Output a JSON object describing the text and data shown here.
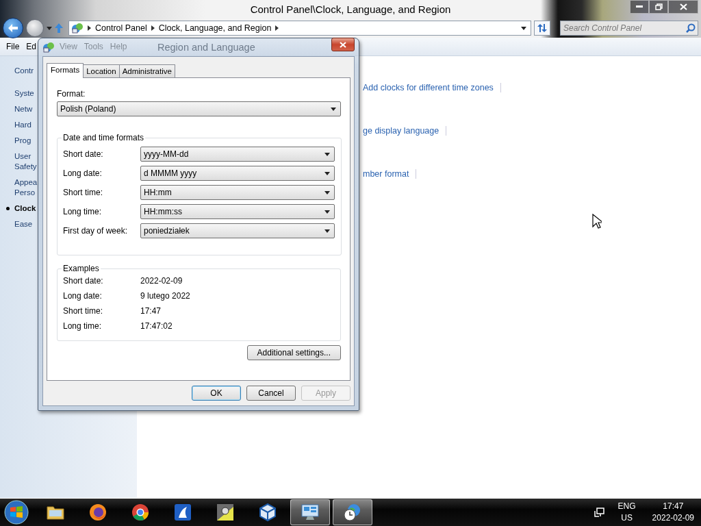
{
  "window": {
    "title": "Control Panel\\Clock, Language, and Region"
  },
  "address_bar": {
    "breadcrumbs": [
      "Control Panel",
      "Clock, Language, and Region"
    ]
  },
  "search": {
    "placeholder": "Search Control Panel"
  },
  "menu": [
    "File",
    "Ed",
    "View",
    "Tools",
    "Help"
  ],
  "sidebar": {
    "items": [
      {
        "lines": [
          "Contr"
        ],
        "selected": false
      },
      {
        "lines": [
          "Syste"
        ],
        "selected": false
      },
      {
        "lines": [
          "Netw"
        ],
        "selected": false
      },
      {
        "lines": [
          "Hard"
        ],
        "selected": false
      },
      {
        "lines": [
          "Prog"
        ],
        "selected": false
      },
      {
        "lines": [
          "User",
          "Safety"
        ],
        "selected": false
      },
      {
        "lines": [
          "Appea",
          "Perso"
        ],
        "selected": false
      },
      {
        "lines": [
          "Clock"
        ],
        "selected": true
      },
      {
        "lines": [
          "Ease"
        ],
        "selected": false
      }
    ]
  },
  "links": [
    "Add clocks for different time zones",
    "ge display language",
    "mber format"
  ],
  "dialog": {
    "title": "Region and Language",
    "tabs": [
      {
        "label": "Formats",
        "selected": true
      },
      {
        "label": "Location",
        "selected": false
      },
      {
        "label": "Administrative",
        "selected": false
      }
    ],
    "format_label": "Format:",
    "format_value": "Polish (Poland)",
    "formats_group": {
      "title": "Date and time formats",
      "rows": [
        {
          "label": "Short date:",
          "value": "yyyy-MM-dd"
        },
        {
          "label": "Long date:",
          "value": "d MMMM yyyy"
        },
        {
          "label": "Short time:",
          "value": "HH:mm"
        },
        {
          "label": "Long time:",
          "value": "HH:mm:ss"
        },
        {
          "label": "First day of week:",
          "value": "poniedziałek"
        }
      ]
    },
    "examples_group": {
      "title": "Examples",
      "rows": [
        {
          "label": "Short date:",
          "value": "2022-02-09"
        },
        {
          "label": "Long date:",
          "value": "9 lutego 2022"
        },
        {
          "label": "Short time:",
          "value": "17:47"
        },
        {
          "label": "Long time:",
          "value": "17:47:02"
        }
      ]
    },
    "additional_button": "Additional settings...",
    "buttons": [
      {
        "label": "OK",
        "default": true,
        "disabled": false
      },
      {
        "label": "Cancel",
        "default": false,
        "disabled": false
      },
      {
        "label": "Apply",
        "default": false,
        "disabled": true
      }
    ]
  },
  "taskbar": {
    "apps": [
      {
        "kind": "folder",
        "active": false
      },
      {
        "kind": "firefox",
        "active": false
      },
      {
        "kind": "chrome",
        "active": false
      },
      {
        "kind": "app",
        "active": false
      },
      {
        "kind": "tool",
        "active": false
      },
      {
        "kind": "cube",
        "active": false
      },
      {
        "kind": "panel",
        "active": true
      },
      {
        "kind": "clock",
        "active": true
      }
    ],
    "tray": {
      "language": "ENG",
      "layout": "US",
      "time": "17:47",
      "date": "2022-02-09"
    }
  }
}
